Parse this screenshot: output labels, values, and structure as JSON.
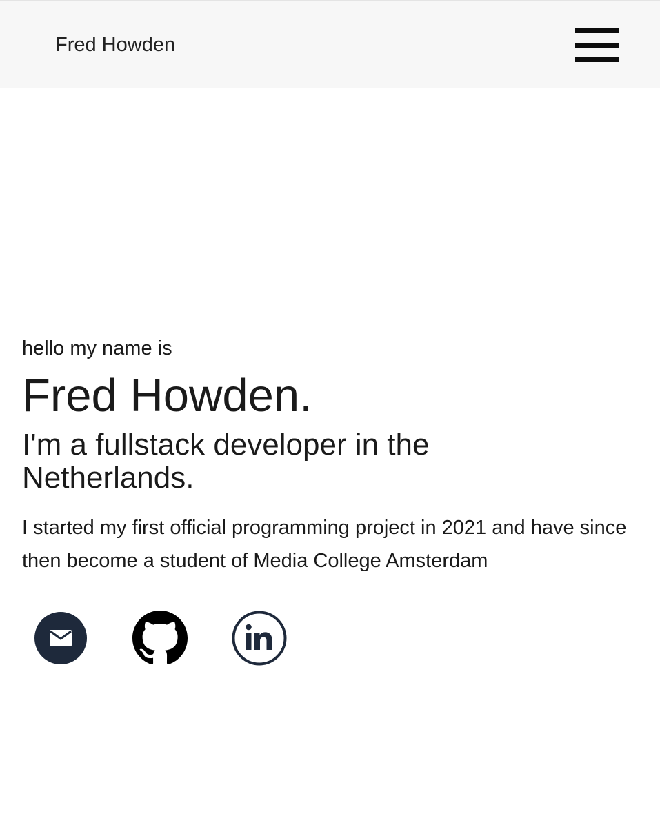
{
  "navbar": {
    "brand": "Fred Howden",
    "menu_icon": "hamburger-menu-icon"
  },
  "hero": {
    "greeting": "hello my name is",
    "name": "Fred Howden.",
    "tagline": "I'm a fullstack developer in the Netherlands.",
    "bio": "I started my first official programming project in 2021 and have since then become a student of Media College Amsterdam"
  },
  "socials": [
    {
      "icon": "email-icon",
      "color": "#1e293b"
    },
    {
      "icon": "github-icon",
      "color": "#000000"
    },
    {
      "icon": "linkedin-icon",
      "color": "#1e293b"
    }
  ]
}
